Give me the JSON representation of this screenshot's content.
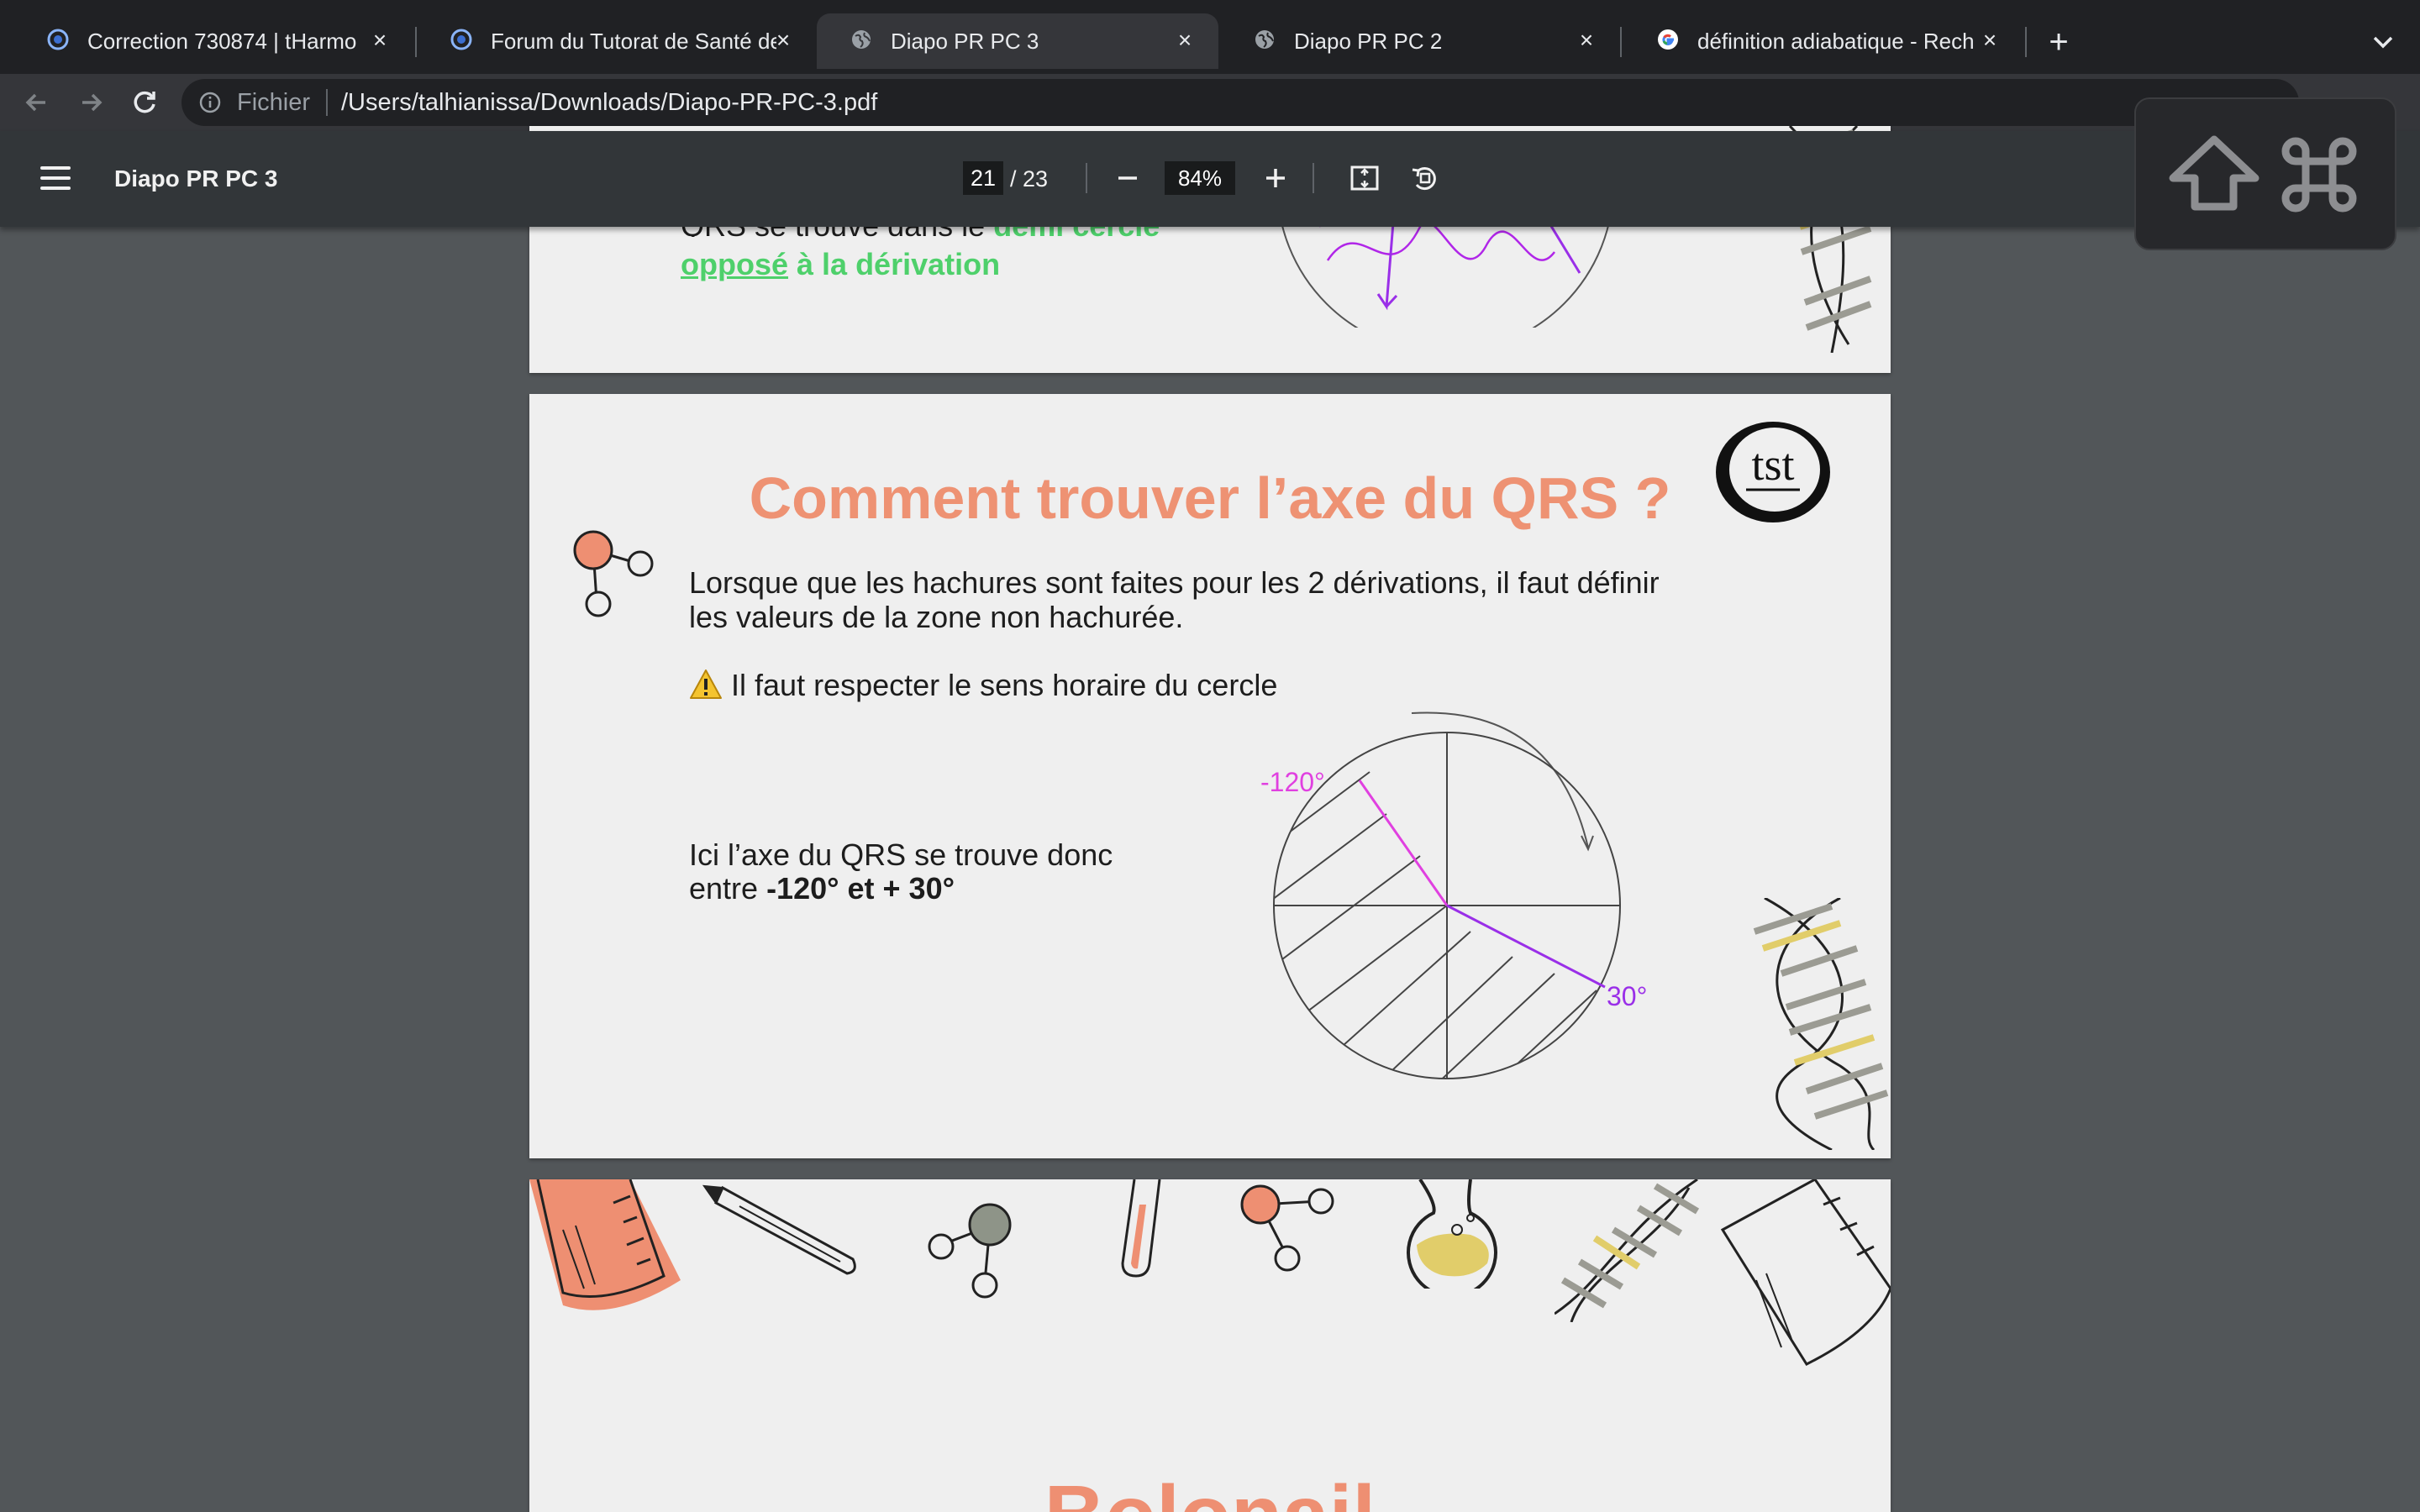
{
  "browser": {
    "tabs": [
      {
        "title": "Correction 730874 | tHarmo",
        "active": false,
        "favicon": "tharmo-icon"
      },
      {
        "title": "Forum du Tutorat de Santé de T",
        "active": false,
        "favicon": "tharmo-icon"
      },
      {
        "title": "Diapo PR PC 3",
        "active": true,
        "favicon": "globe-icon"
      },
      {
        "title": "Diapo PR PC 2",
        "active": false,
        "favicon": "globe-icon"
      },
      {
        "title": "définition adiabatique - Recher",
        "active": false,
        "favicon": "google-icon"
      }
    ],
    "address": {
      "scheme_label": "Fichier",
      "url": "/Users/talhianissa/Downloads/Diapo-PR-PC-3.pdf"
    }
  },
  "pdf_viewer": {
    "title": "Diapo PR PC 3",
    "current_page": "21",
    "total_pages": "/ 23",
    "zoom": "84%"
  },
  "keyboard_overlay": {
    "icons": [
      "shift-icon",
      "command-icon"
    ]
  },
  "pages": {
    "prev": {
      "line1_prefix": "QRS se trouve dans le ",
      "line1_green": "demi cercle",
      "line2_underlined": "opposé",
      "line2_rest": " à la dérivation"
    },
    "current": {
      "title": "Comment trouver l’axe du QRS ?",
      "logo_text": "tst",
      "para1_line1": "Lorsque que les hachures sont faites pour les 2 dérivations, il faut définir",
      "para1_line2": "les valeurs de la zone non hachurée.",
      "warning_text": "Il faut respecter le sens horaire du cercle",
      "axis_line1": "Ici l’axe du QRS se trouve donc",
      "axis_line2_prefix": "entre ",
      "axis_line2_bold": "-120° et + 30°",
      "label_minus120": "-120°",
      "label_30": "30°"
    },
    "next": {
      "title_partial": "Bolonail"
    }
  },
  "colors": {
    "title_salmon": "#ee9273",
    "highlight_green": "#4ed06b",
    "magenta": "#e040e0",
    "purple": "#9a2fe8",
    "tab_bg": "#202124",
    "viewer_bg": "#525659"
  }
}
